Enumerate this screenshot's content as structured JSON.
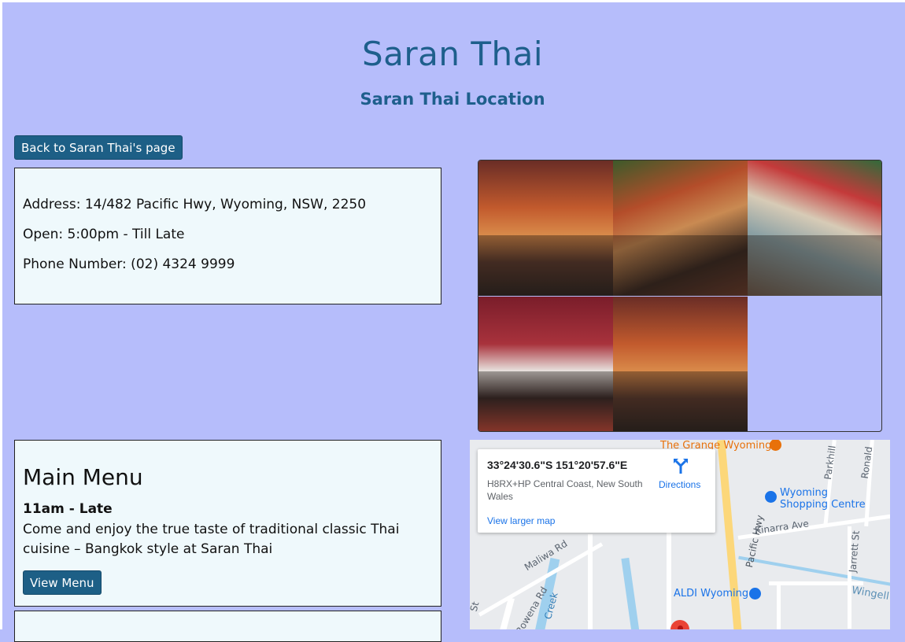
{
  "page": {
    "title": "Saran Thai",
    "subtitle": "Saran Thai Location"
  },
  "back_button": {
    "label": "Back to Saran Thai's page"
  },
  "info": {
    "address": "Address: 14/482 Pacific Hwy, Wyoming, NSW, 2250",
    "open": "Open: 5:00pm - Till Late",
    "phone": "Phone Number: (02) 4324 9999"
  },
  "gallery": {
    "photos": [
      "restaurant-dining-room-photo",
      "decorated-tables-photo",
      "floral-arch-lounge-photo",
      "chef-with-buffet-photo",
      "restaurant-dining-room-photo-2"
    ]
  },
  "menu": {
    "title": "Main Menu",
    "hours": "11am - Late",
    "description": "Come and enjoy the true taste of traditional classic Thai cuisine – Bangkok style at Saran Thai",
    "button_label": "View Menu"
  },
  "map": {
    "card": {
      "coordinates": "33°24'30.6\"S 151°20'57.6\"E",
      "plus_code": "H8RX+HP Central Coast, New South Wales",
      "directions_label": "Directions",
      "larger_map_label": "View larger map"
    },
    "places": {
      "grange": "The Grange Wyoming",
      "wyoming_shopping_1": "Wyoming",
      "wyoming_shopping_2": "Shopping Centre",
      "aldi": "ALDI Wyoming",
      "wingell": "Wingell"
    },
    "streets": {
      "pacific_hwy": "Pacific Hwy",
      "kinarra": "Kinarra Ave",
      "maliwa": "Maliwa Rd",
      "rowena": "Rowena Rd",
      "creek": "Creek",
      "parkhill": "Parkhill",
      "ronald": "Ronald",
      "jarrett": "Jarrett St",
      "st": "St"
    }
  }
}
